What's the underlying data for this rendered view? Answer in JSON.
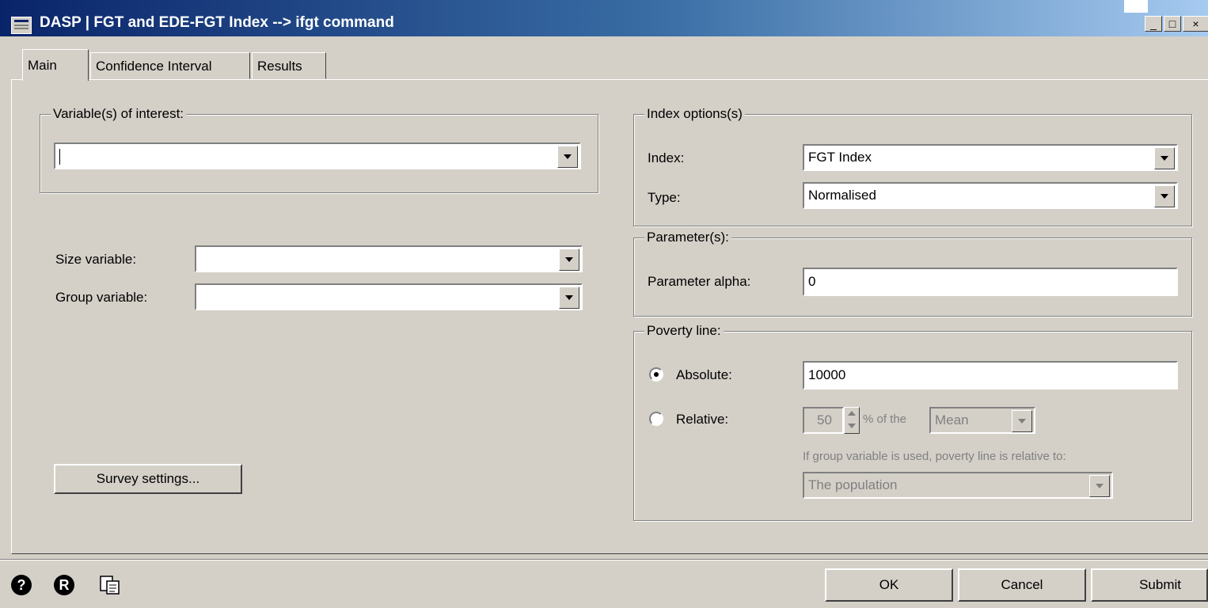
{
  "window": {
    "title": "DASP | FGT and EDE-FGT Index --> ifgt command",
    "controls": [
      "_",
      "□",
      "×"
    ]
  },
  "tabs": [
    {
      "label": "Main",
      "active": true
    },
    {
      "label": "Confidence Interval",
      "active": false
    },
    {
      "label": "Results",
      "active": false
    }
  ],
  "variables": {
    "legend": "Variable(s) of interest:",
    "value": ""
  },
  "size_variable": {
    "label": "Size  variable:",
    "value": ""
  },
  "group_variable": {
    "label": "Group  variable:",
    "value": ""
  },
  "survey_settings_label": "Survey settings...",
  "index_options": {
    "legend": "Index options(s)",
    "index_label": "Index:",
    "index_value": "FGT Index",
    "type_label": "Type:",
    "type_value": "Normalised"
  },
  "parameters": {
    "legend": "Parameter(s):",
    "alpha_label": "Parameter alpha:",
    "alpha_value": "0"
  },
  "poverty_line": {
    "legend": "Poverty line:",
    "absolute_label": "Absolute:",
    "absolute_value": "10000",
    "relative_label": "Relative:",
    "relative_percent": "50",
    "percent_of_label": "% of the",
    "relative_of_value": "Mean",
    "group_note": "If group variable is used, poverty line is relative to:",
    "relative_to_value": "The population"
  },
  "footer": {
    "help_icon_glyph": "?",
    "r_icon_glyph": "R",
    "ok_label": "OK",
    "cancel_label": "Cancel",
    "submit_label": "Submit"
  }
}
